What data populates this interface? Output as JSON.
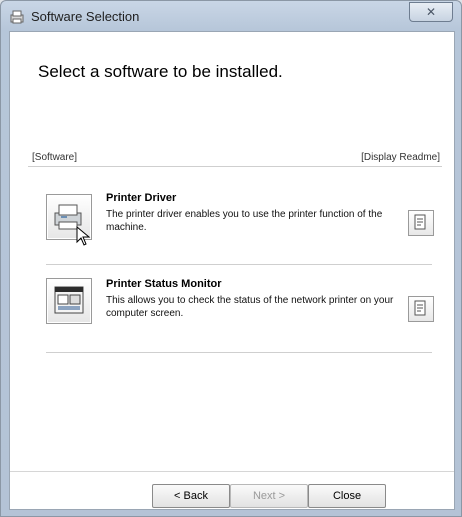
{
  "window": {
    "title": "Software Selection",
    "close_symbol": "✕"
  },
  "main": {
    "heading": "Select a software to be installed."
  },
  "list": {
    "header_left": "[Software]",
    "header_right": "[Display Readme]",
    "items": [
      {
        "title": "Printer Driver",
        "description": "The printer driver enables you to use the printer function of the machine.",
        "icon": "printer-icon"
      },
      {
        "title": "Printer Status Monitor",
        "description": "This allows you to check the status of the network printer on your computer screen.",
        "icon": "status-monitor-icon"
      }
    ]
  },
  "footer": {
    "back_label": "< Back",
    "next_label": "Next >",
    "close_label": "Close"
  }
}
